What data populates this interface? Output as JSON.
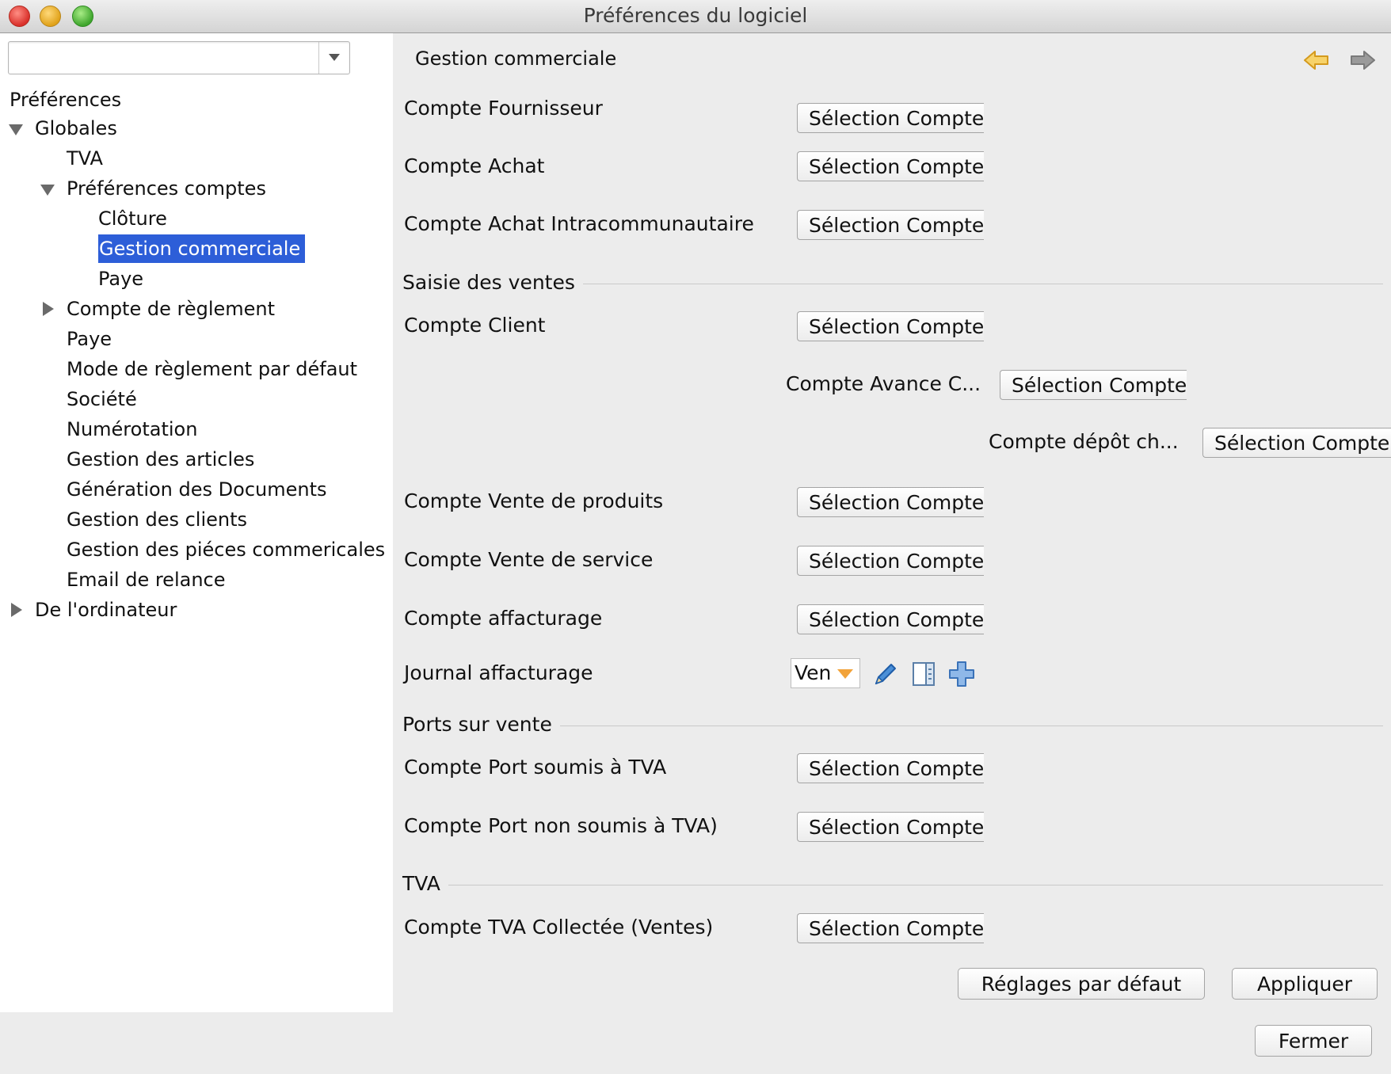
{
  "window": {
    "title": "Préférences du logiciel"
  },
  "sidebar": {
    "filter": {
      "value": "",
      "placeholder": ""
    },
    "tree": [
      {
        "label": "Préférences"
      },
      {
        "label": "Globales"
      },
      {
        "label": "TVA"
      },
      {
        "label": "Préférences comptes"
      },
      {
        "label": "Clôture"
      },
      {
        "label": "Gestion commerciale"
      },
      {
        "label": "Paye"
      },
      {
        "label": "Compte de règlement"
      },
      {
        "label": "Paye"
      },
      {
        "label": "Mode de règlement par défaut"
      },
      {
        "label": "Société"
      },
      {
        "label": "Numérotation"
      },
      {
        "label": "Gestion des articles"
      },
      {
        "label": "Génération des Documents"
      },
      {
        "label": "Gestion des clients"
      },
      {
        "label": "Gestion des piéces commericales"
      },
      {
        "label": "Email de relance"
      },
      {
        "label": "De l'ordinateur"
      }
    ],
    "selected": "Gestion commerciale"
  },
  "main": {
    "header_title": "Gestion commerciale",
    "select_label": "Sélection Compte",
    "rows": {
      "compte_fournisseur": "Compte Fournisseur",
      "compte_achat": "Compte Achat",
      "compte_achat_intra": "Compte Achat Intracommunautaire",
      "compte_client": "Compte Client",
      "compte_avance": "Compte Avance C...",
      "compte_depot": "Compte dépôt ch...",
      "compte_vente_produits": "Compte Vente de produits",
      "compte_vente_service": "Compte Vente de service",
      "compte_affacturage": "Compte affacturage",
      "journal_affacturage": "Journal affacturage",
      "compte_port_tva": "Compte Port soumis à TVA",
      "compte_port_non_tva": "Compte Port non soumis à TVA)",
      "compte_tva_collectee": "Compte TVA Collectée (Ventes)"
    },
    "sections": {
      "saisie_ventes": "Saisie des ventes",
      "ports_vente": "Ports sur vente",
      "tva": "TVA"
    },
    "journal_value": "Ven",
    "icons": {
      "back": "back-arrow-icon",
      "forward": "forward-arrow-icon",
      "edit": "pencil-icon",
      "list": "list-icon",
      "add": "plus-icon"
    },
    "buttons": {
      "defaults": "Réglages par défaut",
      "apply": "Appliquer",
      "close": "Fermer"
    }
  },
  "colors": {
    "selection": "#2d5ed8",
    "background": "#ececec",
    "sidebar": "#ffffff",
    "accent_orange": "#f2a33a",
    "accent_blue": "#4a8fd8"
  }
}
